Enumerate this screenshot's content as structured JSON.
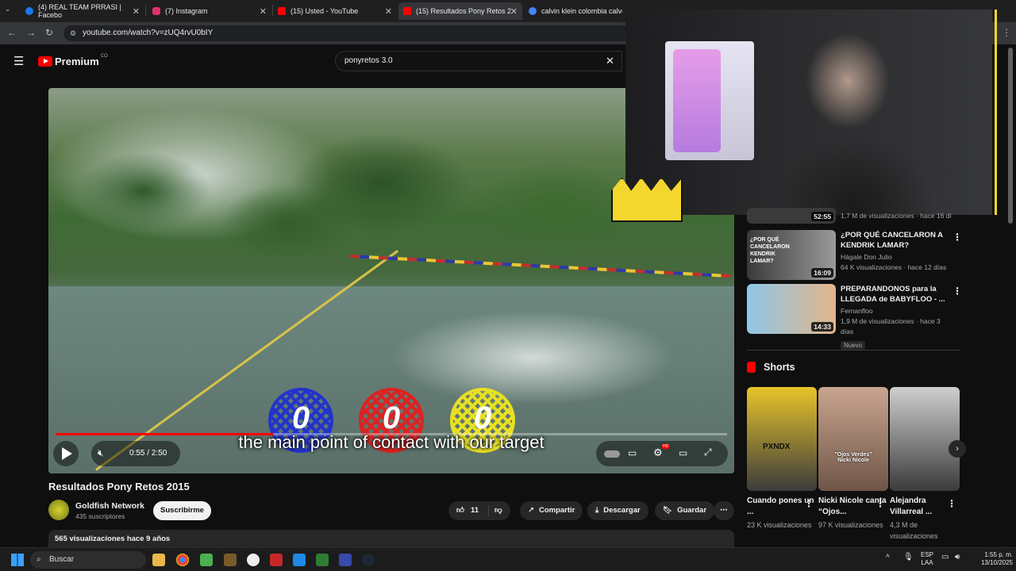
{
  "browser": {
    "tabs": [
      {
        "label": "(4) REAL TEAM PRRASI | Facebo",
        "color": "#1877f2"
      },
      {
        "label": "(7) Instagram",
        "color": "#e1306c"
      },
      {
        "label": "(15) Usted - YouTube",
        "color": "#ff0000"
      },
      {
        "label": "(15) Resultados Pony Retos 201",
        "color": "#ff0000"
      },
      {
        "label": "calvin klein colombia calvo y",
        "color": "#4285f4"
      }
    ],
    "url": "youtube.com/watch?v=zUQ4rvU0bIY"
  },
  "youtube": {
    "logo_text": "Premium",
    "logo_country": "CO",
    "search_query": "ponyretos 3.0"
  },
  "video": {
    "subtitle": "the main point of contact with our target",
    "time": "0:55 / 2:50",
    "progress": 0.324,
    "scores": [
      {
        "value": "0",
        "color": "#2233cc"
      },
      {
        "value": "0",
        "color": "#dd2222"
      },
      {
        "value": "0",
        "color": "#e8e022"
      }
    ],
    "hd_badge": "HD",
    "title": "Resultados Pony Retos 2015",
    "channel": "Goldfish Network",
    "subscribers": "435 suscriptores",
    "subscribe_label": "Suscribirme",
    "likes": "11",
    "share_label": "Compartir",
    "download_label": "Descargar",
    "save_label": "Guardar",
    "description_meta": "565 visualizaciones  hace 9 años"
  },
  "recommendations": {
    "partial": {
      "duration": "52:55",
      "sub": "1,7 M de visualizaciones · hace 16 días"
    },
    "items": [
      {
        "title": "¿POR QUÉ CANCELARON A KENDRIK LAMAR?",
        "channel": "Hágale Don Julio",
        "stats": "64 K visualizaciones · hace 12 días",
        "duration": "16:09",
        "thumb_text": "¿POR QUÉ CANCELARON KENDRIK LAMAR?",
        "colors": [
          "#3a3a3a",
          "#9a9a9a"
        ]
      },
      {
        "title": "PREPARANDONOS para la LLEGADA de BABYFLOO - ...",
        "channel": "Fernanfloo",
        "stats": "1,9 M de visualizaciones · hace 3 días",
        "duration": "14:33",
        "badge": "Nuevo",
        "colors": [
          "#8fc7e8",
          "#e2b58a"
        ]
      }
    ],
    "shorts_label": "Shorts",
    "shorts": [
      {
        "title": "Cuando pones un ...",
        "views": "23 K visualizaciones",
        "thumb_text": "PXNDX",
        "colors": [
          "#e8c42a",
          "#3b3b3b"
        ]
      },
      {
        "title": "Nicki Nicole canta “Ojos...",
        "views": "97 K visualizaciones",
        "thumb_text": "\"Ojos Verdes\" Nicki Nicole",
        "colors": [
          "#c9a58f",
          "#6f5548"
        ]
      },
      {
        "title": "Alejandra Villarreal ...",
        "views": "4,3 M de visualizaciones",
        "colors": [
          "#cfcfcf",
          "#3b3b3b"
        ]
      }
    ]
  },
  "taskbar": {
    "search_label": "Buscar",
    "lang": "ESP",
    "lang2": "LAA",
    "time": "1:55 p. m.",
    "date": "13/10/2025"
  }
}
